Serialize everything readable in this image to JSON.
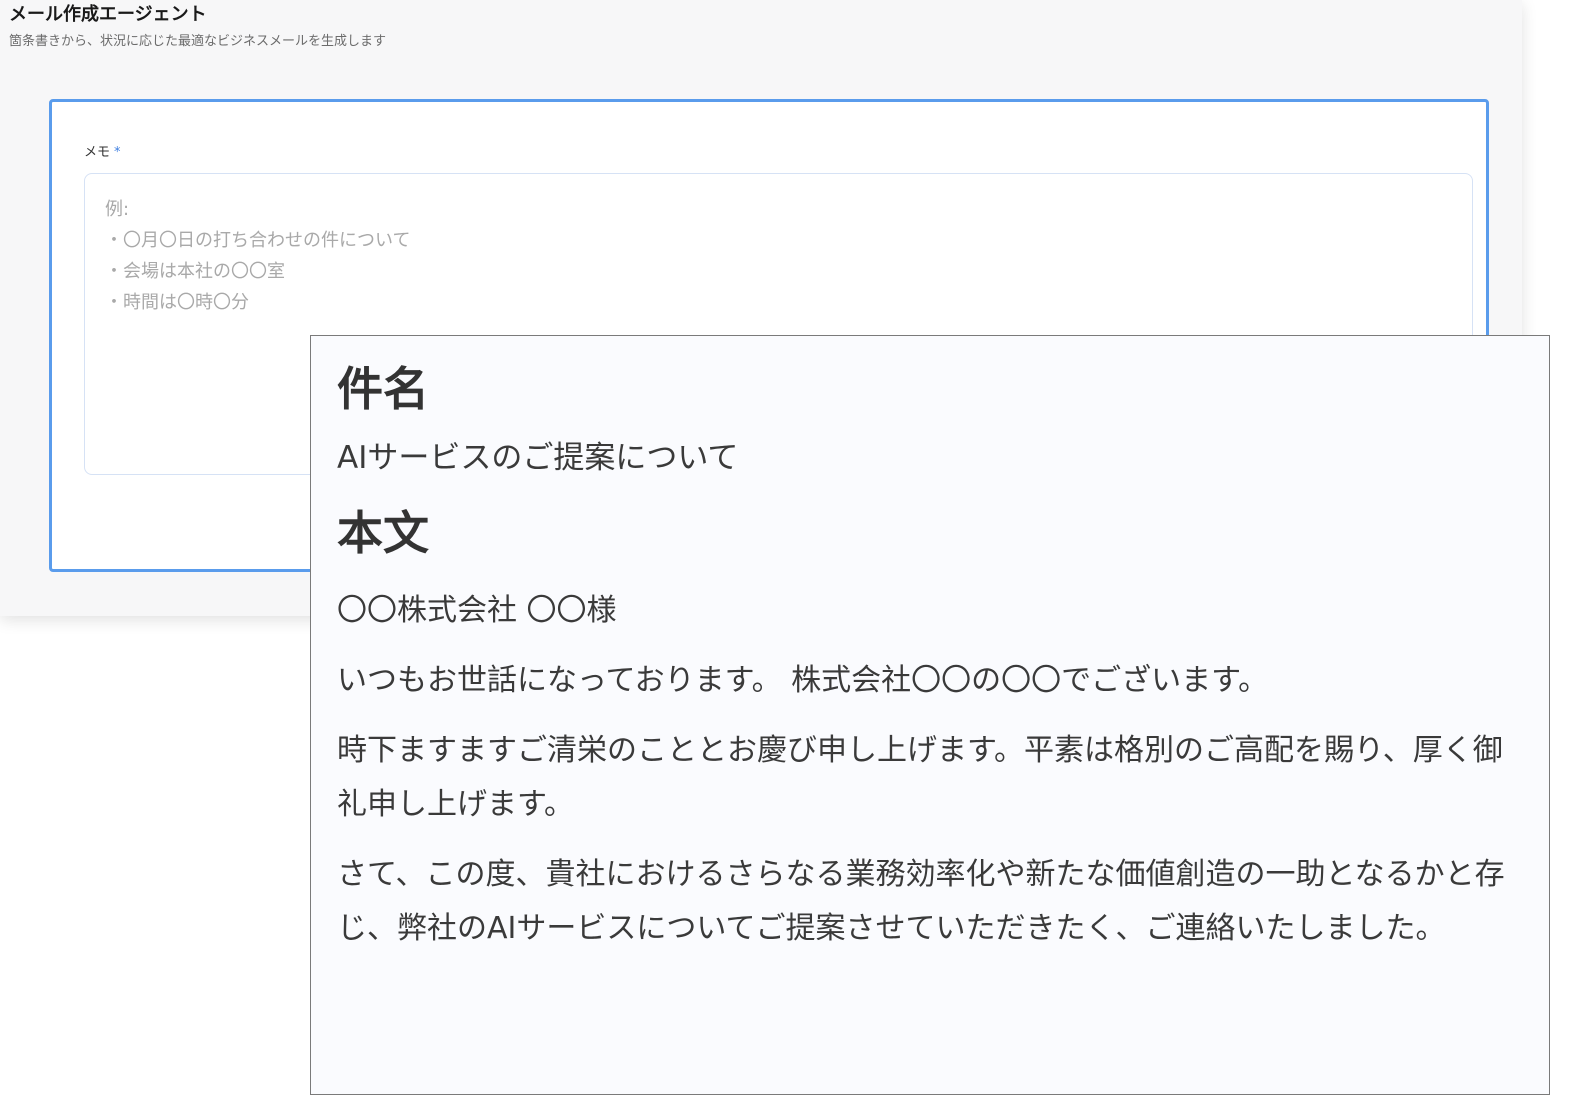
{
  "app": {
    "title": "メール作成エージェント",
    "subtitle": "箇条書きから、状況に応じた最適なビジネスメールを生成します"
  },
  "form": {
    "memo_label": "メモ",
    "required_mark": "*",
    "memo_value": "",
    "memo_placeholder": "例:\n・〇月〇日の打ち合わせの件について\n・会場は本社の〇〇室\n・時間は〇時〇分"
  },
  "output": {
    "subject_heading": "件名",
    "subject": "AIサービスのご提案について",
    "body_heading": "本文",
    "body_paragraphs": [
      "〇〇株式会社 〇〇様",
      "いつもお世話になっております。 株式会社〇〇の〇〇でございます。",
      "時下ますますご清栄のこととお慶び申し上げます。平素は格別のご高配を賜り、厚く御礼申し上げます。",
      "さて、この度、貴社におけるさらなる業務効率化や新たな価値創造の一助となるかと存じ、弊社のAIサービスについてご提案させていただきたく、ご連絡いたしました。"
    ]
  },
  "colors": {
    "accent": "#5a9cec",
    "required": "#3f7fe0",
    "output_background": "#fafbfe"
  }
}
